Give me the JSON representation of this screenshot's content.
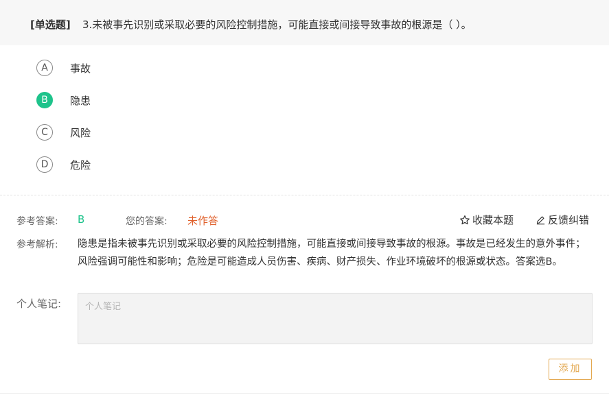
{
  "question": {
    "type_label": "[单选题]",
    "text": "3.未被事先识别或采取必要的风险控制措施，可能直接或间接导致事故的根源是（   ）。"
  },
  "options": [
    {
      "letter": "A",
      "text": "事故",
      "selected": false
    },
    {
      "letter": "B",
      "text": "隐患",
      "selected": true
    },
    {
      "letter": "C",
      "text": "风险",
      "selected": false
    },
    {
      "letter": "D",
      "text": "危险",
      "selected": false
    }
  ],
  "answer": {
    "ref_label": "参考答案:",
    "ref_value": "B",
    "mine_label": "您的答案:",
    "mine_value": "未作答"
  },
  "actions": {
    "favorite": "收藏本题",
    "feedback": "反馈纠错"
  },
  "analysis": {
    "label": "参考解析:",
    "text": "隐患是指未被事先识别或采取必要的风险控制措施，可能直接或间接导致事故的根源。事故是已经发生的意外事件；风险强调可能性和影响；危险是可能造成人员伤害、疾病、财产损失、作业环境破坏的根源或状态。答案选B。"
  },
  "notes": {
    "label": "个人笔记:",
    "placeholder": "个人笔记",
    "add_button": "添加"
  },
  "colors": {
    "correct": "#1ec38b",
    "unanswered": "#e0602b",
    "add_button": "#e3a850"
  }
}
